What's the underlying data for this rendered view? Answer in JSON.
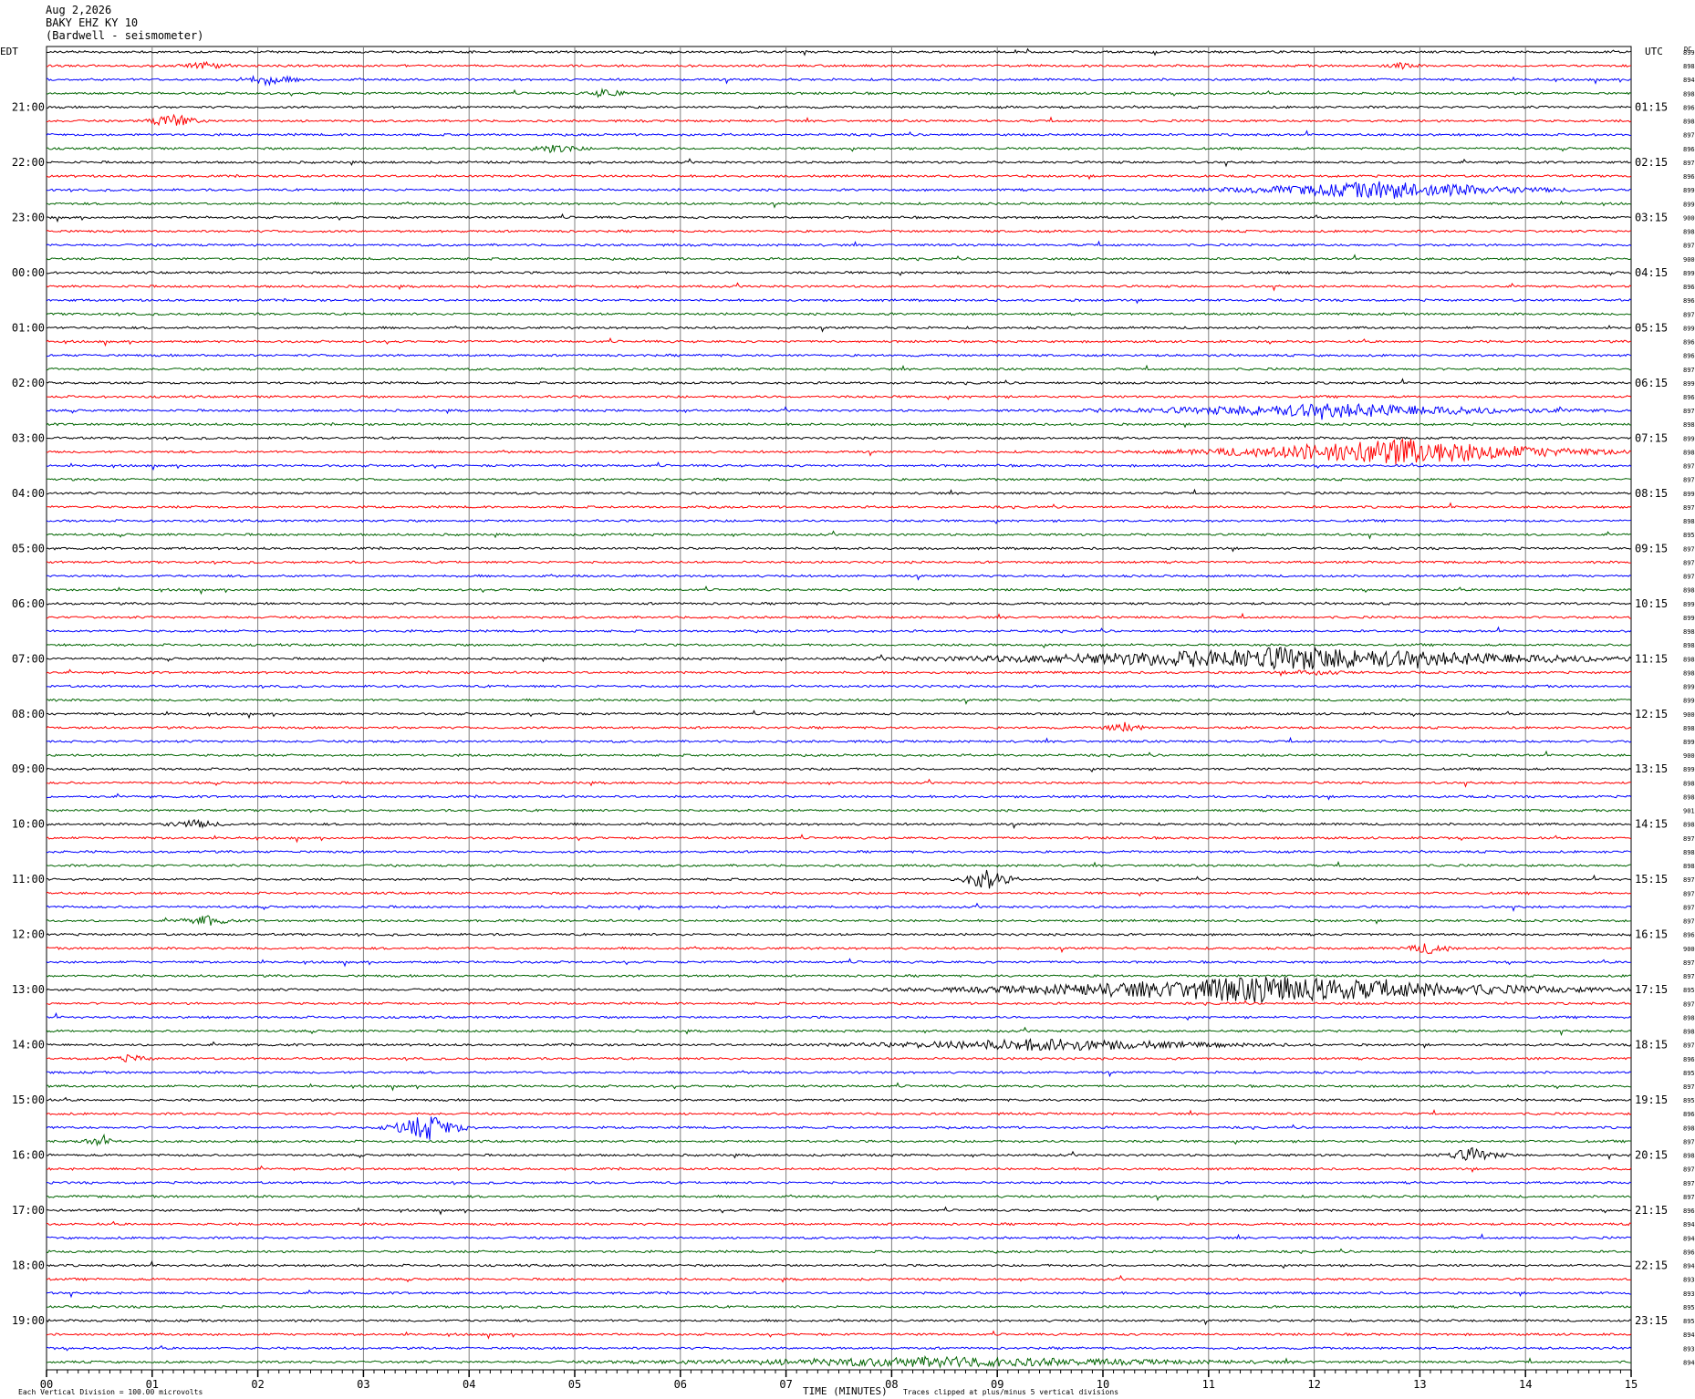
{
  "header": {
    "date": "Aug 2,2026",
    "station": "BAKY EHZ KY 10",
    "location": "(Bardwell - seismometer)"
  },
  "left_tz": "EDT",
  "right_tz": "UTC",
  "dc_label": "DC",
  "footer": {
    "scale_note": "Each Vertical Division =  100.00 microvolts",
    "xaxis_title": "TIME (MINUTES)",
    "clip_note": "Traces clipped at plus/minus 5 vertical divisions"
  },
  "trace_colors": [
    "#000000",
    "#ff0000",
    "#0000ff",
    "#006400"
  ],
  "grid_color": "#808080",
  "chart_data": {
    "type": "line",
    "title": "BAKY EHZ KY 10",
    "xlabel": "TIME (MINUTES)",
    "xlim": [
      0,
      15
    ],
    "x_ticks": [
      "00",
      "01",
      "02",
      "03",
      "04",
      "05",
      "06",
      "07",
      "08",
      "09",
      "10",
      "11",
      "12",
      "13",
      "14",
      "15"
    ],
    "rows_per_hour": 4,
    "row_count": 96,
    "left_hour_labels": [
      "21:00",
      "22:00",
      "23:00",
      "00:00",
      "01:00",
      "02:00",
      "03:00",
      "04:00",
      "05:00",
      "06:00",
      "07:00",
      "08:00",
      "09:00",
      "10:00",
      "11:00",
      "12:00",
      "13:00",
      "14:00",
      "15:00",
      "16:00",
      "17:00",
      "18:00",
      "19:00"
    ],
    "right_hour_labels": [
      "01:15",
      "02:15",
      "03:15",
      "04:15",
      "05:15",
      "06:15",
      "07:15",
      "08:15",
      "09:15",
      "10:15",
      "11:15",
      "12:15",
      "13:15",
      "14:15",
      "15:15",
      "16:15",
      "17:15",
      "18:15",
      "19:15",
      "20:15",
      "21:15",
      "22:15",
      "23:15"
    ],
    "dc_offsets": [
      899,
      898,
      894,
      898,
      896,
      898,
      897,
      896,
      897,
      896,
      899,
      899,
      900,
      898,
      897,
      900,
      899,
      896,
      896,
      897,
      899,
      896,
      896,
      897,
      899,
      896,
      897,
      898,
      899,
      898,
      897,
      897,
      899,
      897,
      898,
      895,
      897,
      897,
      897,
      898,
      899,
      899,
      898,
      898,
      898,
      898,
      899,
      899,
      900,
      898,
      899,
      900,
      899,
      898,
      898,
      901,
      898,
      897,
      898,
      898,
      897,
      897,
      897,
      897,
      896,
      900,
      897,
      897,
      895,
      897,
      898,
      898,
      897,
      896,
      895,
      897,
      895,
      896,
      898,
      897,
      898,
      897,
      897,
      897,
      896,
      894,
      894,
      896,
      894,
      893,
      893,
      895,
      895,
      894,
      893,
      894
    ],
    "events": [
      {
        "row": 1,
        "minute": 1.5,
        "amp": 4,
        "dur": 0.4
      },
      {
        "row": 1,
        "minute": 12.8,
        "amp": 3,
        "dur": 0.3
      },
      {
        "row": 2,
        "minute": 2.1,
        "amp": 5,
        "dur": 0.5
      },
      {
        "row": 3,
        "minute": 5.3,
        "amp": 5,
        "dur": 0.3
      },
      {
        "row": 5,
        "minute": 1.2,
        "amp": 8,
        "dur": 0.4
      },
      {
        "row": 7,
        "minute": 4.8,
        "amp": 4,
        "dur": 0.5
      },
      {
        "row": 10,
        "minute": 12.7,
        "amp": 9,
        "dur": 2.5
      },
      {
        "row": 26,
        "minute": 12.2,
        "amp": 7,
        "dur": 3.5
      },
      {
        "row": 29,
        "minute": 12.8,
        "amp": 14,
        "dur": 3.0
      },
      {
        "row": 44,
        "minute": 11.8,
        "amp": 12,
        "dur": 5.0
      },
      {
        "row": 45,
        "minute": 12.0,
        "amp": 3,
        "dur": 0.5
      },
      {
        "row": 49,
        "minute": 10.2,
        "amp": 6,
        "dur": 0.3
      },
      {
        "row": 56,
        "minute": 1.4,
        "amp": 4,
        "dur": 0.5
      },
      {
        "row": 60,
        "minute": 8.9,
        "amp": 12,
        "dur": 0.4
      },
      {
        "row": 63,
        "minute": 1.5,
        "amp": 6,
        "dur": 0.4
      },
      {
        "row": 65,
        "minute": 13.1,
        "amp": 6,
        "dur": 0.4
      },
      {
        "row": 68,
        "minute": 11.6,
        "amp": 14,
        "dur": 4.5
      },
      {
        "row": 72,
        "minute": 9.5,
        "amp": 6,
        "dur": 3.0
      },
      {
        "row": 73,
        "minute": 0.8,
        "amp": 4,
        "dur": 0.3
      },
      {
        "row": 78,
        "minute": 3.6,
        "amp": 14,
        "dur": 0.6
      },
      {
        "row": 79,
        "minute": 0.5,
        "amp": 4,
        "dur": 0.3
      },
      {
        "row": 80,
        "minute": 13.5,
        "amp": 7,
        "dur": 0.5
      },
      {
        "row": 95,
        "minute": 8.5,
        "amp": 5,
        "dur": 4.5
      }
    ]
  }
}
